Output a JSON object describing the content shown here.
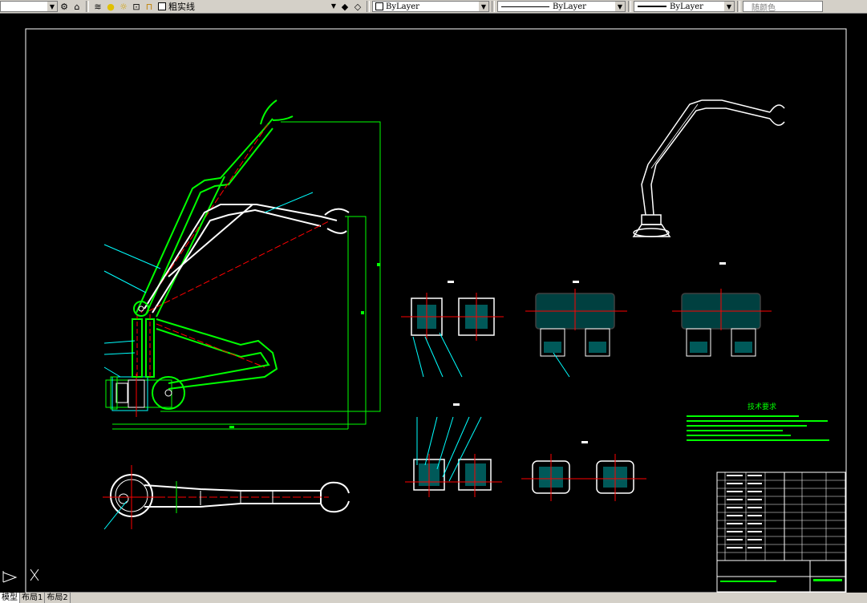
{
  "toolbar": {
    "linetype_label": "粗实线",
    "color_combo": "ByLayer",
    "linetype_combo": "ByLayer",
    "lineweight_combo": "ByLayer",
    "plotstyle_combo": "随颜色"
  },
  "tabs": [
    {
      "label": "模型"
    },
    {
      "label": "布局1"
    },
    {
      "label": "布局2"
    }
  ],
  "notes_title": "技术要求",
  "colors": {
    "accent_green": "#00ff00",
    "line_white": "#ffffff",
    "center_red": "#ff0000",
    "cyan": "#00ffff"
  }
}
